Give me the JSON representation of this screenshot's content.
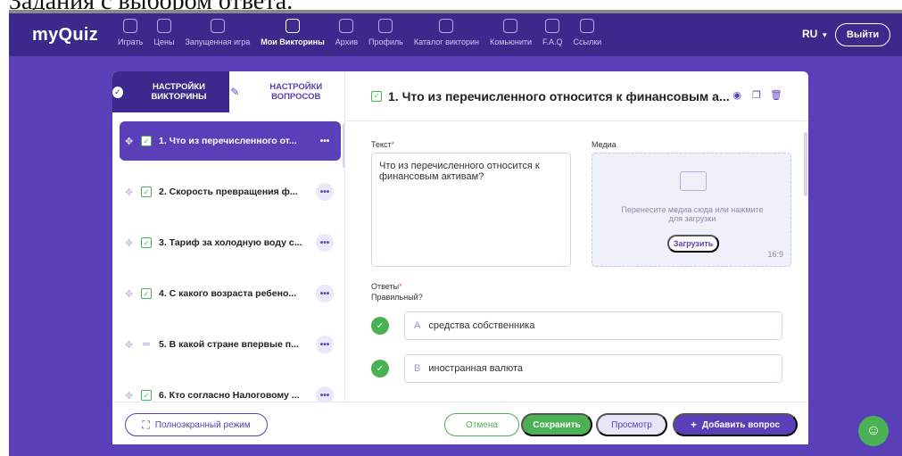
{
  "document": {
    "caption_fragment": "Задания с выбором ответа."
  },
  "app": {
    "logo": "myQuiz",
    "nav": [
      {
        "label": "Играть",
        "icon": "gamepad-icon"
      },
      {
        "label": "Цены",
        "icon": "wallet-icon"
      },
      {
        "label": "Запущенная игра",
        "icon": "trophy-icon"
      },
      {
        "label": "Мои Викторины",
        "icon": "quiz-icon",
        "active": true
      },
      {
        "label": "Архив",
        "icon": "archive-icon"
      },
      {
        "label": "Профиль",
        "icon": "profile-icon"
      },
      {
        "label": "Каталог викторин",
        "icon": "catalog-icon"
      },
      {
        "label": "Комьюнити",
        "icon": "star-icon"
      },
      {
        "label": "F.A.Q",
        "icon": "question-icon"
      },
      {
        "label": "Ссылки",
        "icon": "link-icon"
      }
    ],
    "lang": "RU",
    "logout_label": "Выйти"
  },
  "left_panel": {
    "tab_quiz_settings": "НАСТРОЙКИ ВИКТОРИНЫ",
    "tab_question_settings": "НАСТРОЙКИ ВОПРОСОВ",
    "questions": [
      {
        "text": "1. Что из перечисленного от...",
        "active": true,
        "type": "checkbox"
      },
      {
        "text": "2. Скорость превращения ф...",
        "type": "checkbox"
      },
      {
        "text": "3. Тариф за холодную воду с...",
        "type": "checkbox"
      },
      {
        "text": "4. С какого возраста ребено...",
        "type": "checkbox"
      },
      {
        "text": "5. В какой стране впервые п...",
        "type": "lines"
      },
      {
        "text": "6. Кто согласно Налоговому ...",
        "type": "checkbox"
      }
    ],
    "more_label": "•••"
  },
  "right_panel": {
    "title": "1. Что из перечисленного относится к финансовым а...",
    "text_label": "Текст",
    "required_mark": "*",
    "text_value": "Что из перечисленного относится к финансовым активам?",
    "media_label": "Медиа",
    "media_hint": "Перенесите медиа сюда или нажмите для загрузки",
    "upload_label": "Загрузить",
    "ratio": "16:9",
    "answers_label": "Ответы",
    "correct_label": "Правильный?",
    "answers": [
      {
        "letter": "A",
        "text": "средства собственника",
        "correct": true
      },
      {
        "letter": "B",
        "text": "иностранная валюта",
        "correct": true
      }
    ]
  },
  "bottom_bar": {
    "fullscreen_label": "Полноэкранный режим",
    "cancel_label": "Отмена",
    "save_label": "Сохранить",
    "preview_label": "Просмотр",
    "add_question_label": "Добавить вопрос"
  },
  "colors": {
    "brand_purple": "#5b3fb8",
    "header_purple": "#3b2a8c",
    "green": "#4ab254"
  }
}
